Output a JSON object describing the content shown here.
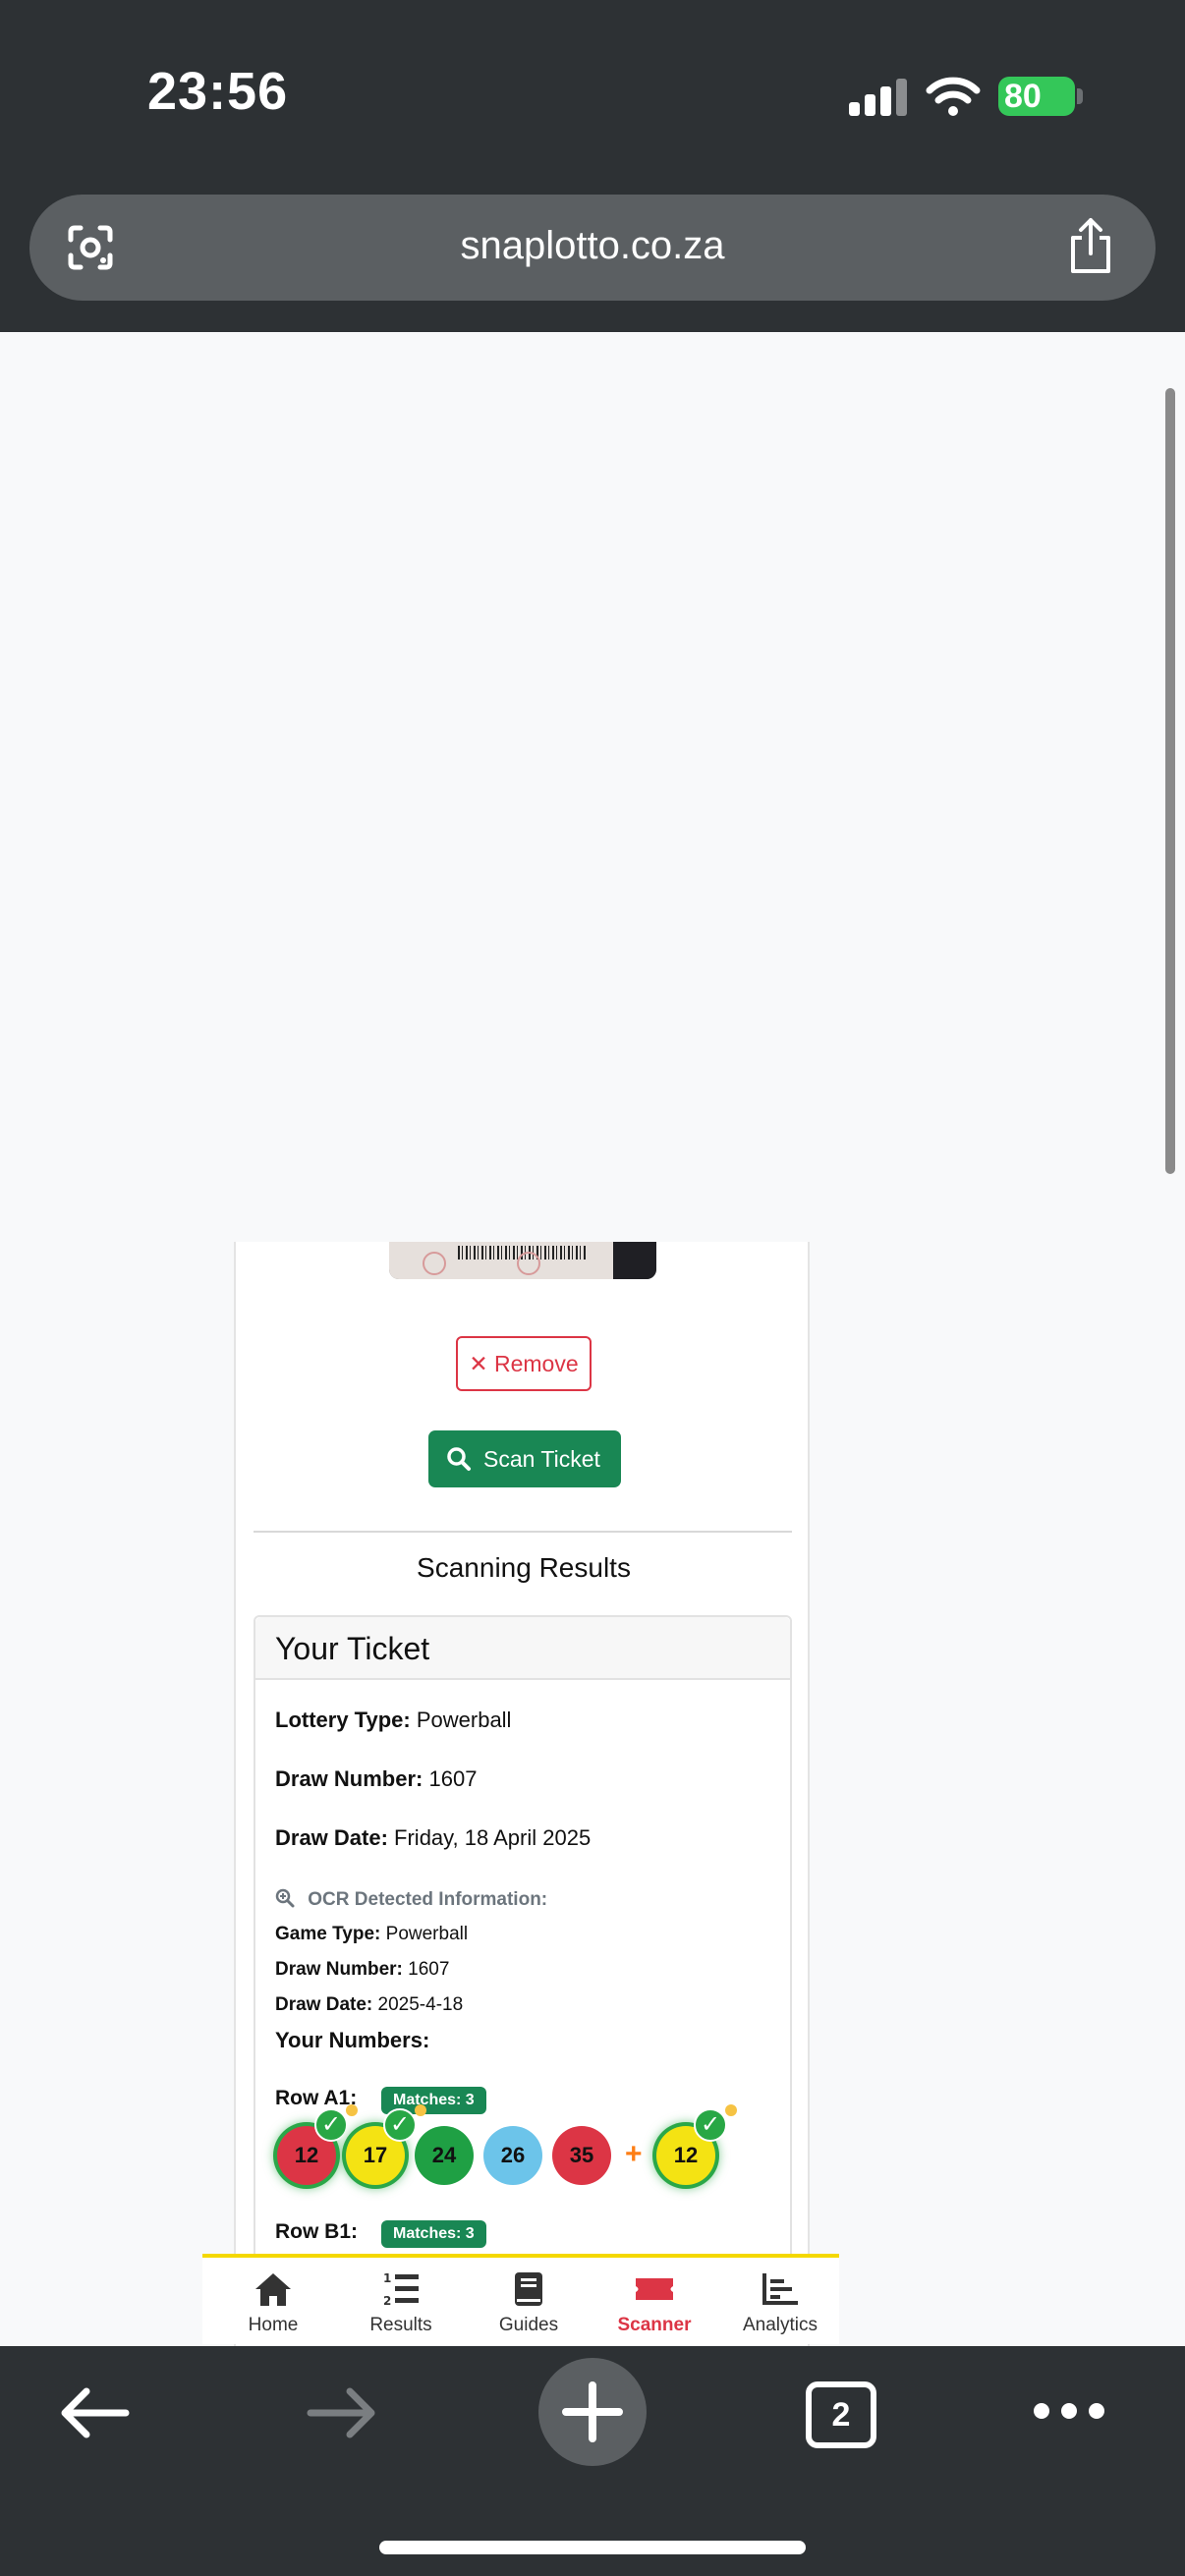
{
  "status_bar": {
    "time": "23:56",
    "battery": "80"
  },
  "browser": {
    "url": "snaplotto.co.za",
    "tab_count": "2"
  },
  "upload": {
    "remove_label": "Remove",
    "scan_label": "Scan Ticket"
  },
  "results": {
    "title": "Scanning Results",
    "card_title": "Your Ticket",
    "lottery_type_label": "Lottery Type:",
    "lottery_type": "Powerball",
    "draw_number_label": "Draw Number:",
    "draw_number": "1607",
    "draw_date_label": "Draw Date:",
    "draw_date": "Friday, 18 April 2025",
    "ocr_title": "OCR Detected Information:",
    "ocr_game_type_label": "Game Type:",
    "ocr_game_type": "Powerball",
    "ocr_draw_number_label": "Draw Number:",
    "ocr_draw_number": "1607",
    "ocr_draw_date_label": "Draw Date:",
    "ocr_draw_date": "2025-4-18",
    "your_numbers_label": "Your Numbers:",
    "rows": [
      {
        "label": "Row A1:",
        "matches": "Matches: 3",
        "balls": [
          {
            "number": "12",
            "color": "red",
            "matched": true
          },
          {
            "number": "17",
            "color": "yellow",
            "matched": true
          },
          {
            "number": "24",
            "color": "green",
            "matched": false
          },
          {
            "number": "26",
            "color": "blue",
            "matched": false
          },
          {
            "number": "35",
            "color": "red",
            "matched": false
          }
        ],
        "plus": "+",
        "powerball": {
          "number": "12",
          "color": "yellow",
          "matched": true
        }
      },
      {
        "label": "Row B1:",
        "matches": "Matches: 3"
      }
    ]
  },
  "bottom_nav": [
    {
      "label": "Home",
      "icon": "home-icon",
      "active": false
    },
    {
      "label": "Results",
      "icon": "list-ordered-icon",
      "active": false
    },
    {
      "label": "Guides",
      "icon": "book-icon",
      "active": false
    },
    {
      "label": "Scanner",
      "icon": "ticket-icon",
      "active": true
    },
    {
      "label": "Analytics",
      "icon": "bar-chart-icon",
      "active": false
    }
  ],
  "colors": {
    "brand_green": "#198754",
    "danger_red": "#dc3545",
    "nav_accent": "#f4d800"
  }
}
